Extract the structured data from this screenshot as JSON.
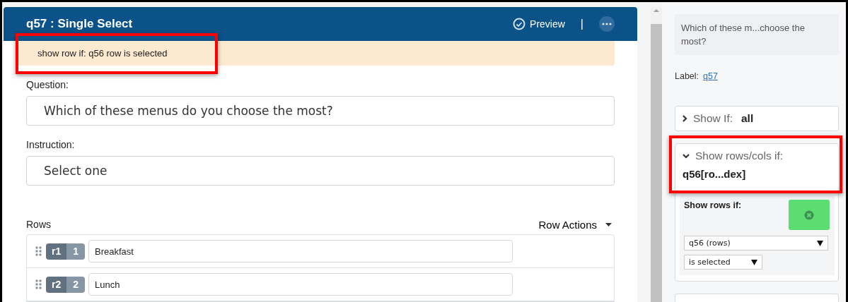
{
  "editor": {
    "title": "q57 : Single Select",
    "preview": "Preview",
    "separator": "|",
    "notice": {
      "text": "show row if: q56 row is selected",
      "highlighted": true
    },
    "question": {
      "label": "Question:",
      "value": "Which of these menus do you choose the most?"
    },
    "instruction": {
      "label": "Instruction:",
      "value": "Select one"
    },
    "rows_label": "Rows",
    "row_actions": "Row Actions",
    "rows": [
      {
        "id": "r1",
        "index": "1",
        "value": "Breakfast"
      },
      {
        "id": "r2",
        "index": "2",
        "value": "Lunch"
      }
    ]
  },
  "sidebar": {
    "question_preview": "Which of these m...choose the most?",
    "label_caption": "Label:",
    "label_link": "q57",
    "sections": [
      {
        "title": "Show If:",
        "value": "all",
        "expanded": false,
        "highlighted": false
      },
      {
        "title": "Show rows/cols if:",
        "value": "q56[ro...dex]",
        "expanded": true,
        "highlighted": true,
        "condition": {
          "label": "Show rows if:",
          "source": "q56 (rows)",
          "operator": "is selected"
        }
      }
    ]
  }
}
